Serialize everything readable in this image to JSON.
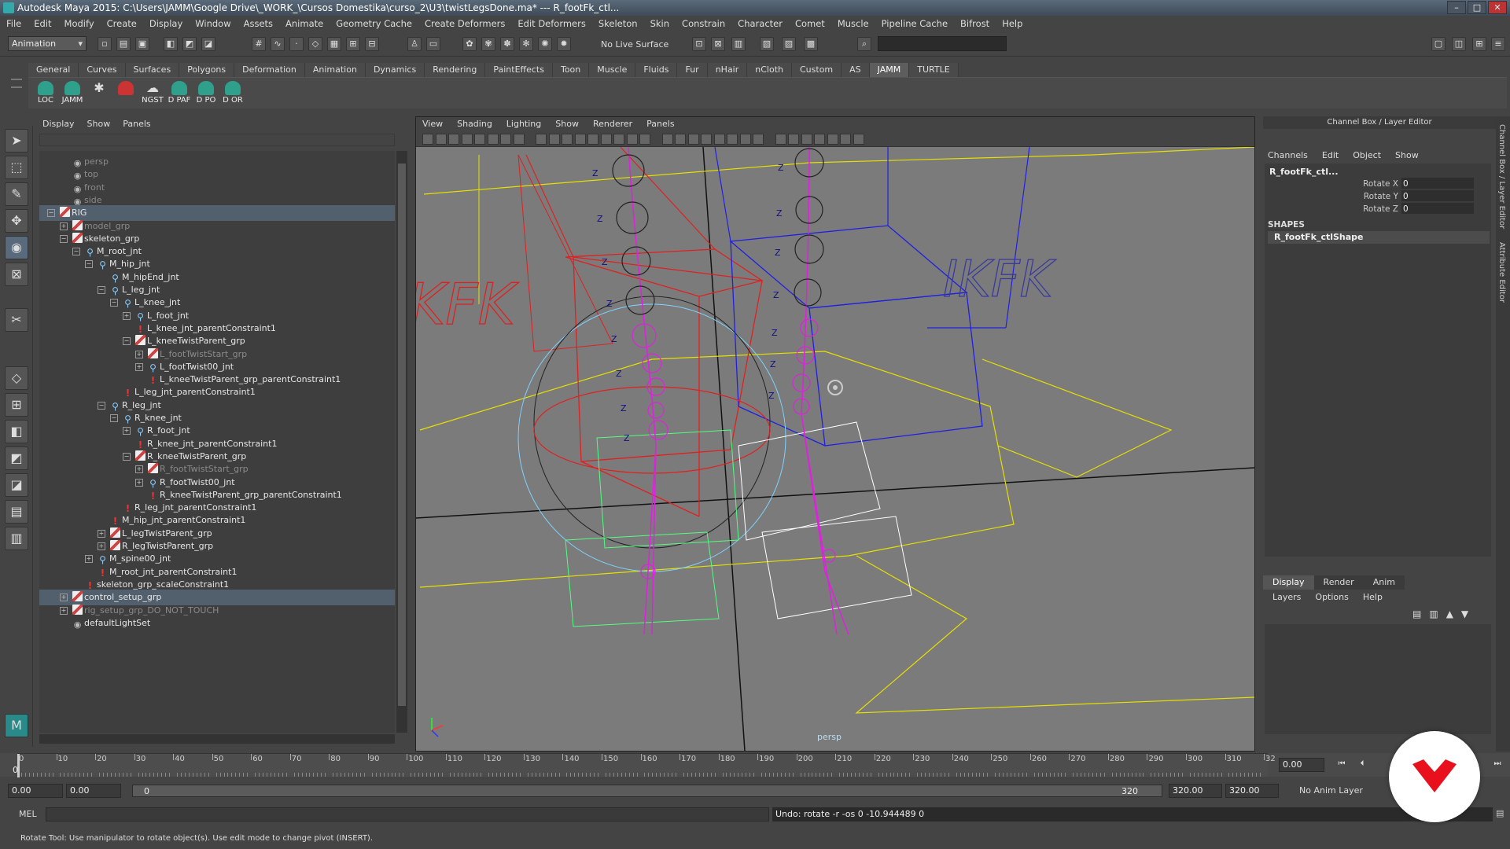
{
  "window": {
    "title": "Autodesk Maya 2015: C:\\Users\\JAMM\\Google Drive\\_WORK_\\Cursos Domestika\\curso_2\\U3\\twistLegsDone.ma*   ---   R_footFk_ctl..."
  },
  "menus": [
    "File",
    "Edit",
    "Modify",
    "Create",
    "Display",
    "Window",
    "Assets",
    "Animate",
    "Geometry Cache",
    "Create Deformers",
    "Edit Deformers",
    "Skeleton",
    "Skin",
    "Constrain",
    "Character",
    "Comet",
    "Muscle",
    "Pipeline Cache",
    "Bifrost",
    "Help"
  ],
  "toolbar": {
    "mode": "Animation",
    "live_surface": "No Live Surface"
  },
  "shelf_tabs": [
    "General",
    "Curves",
    "Surfaces",
    "Polygons",
    "Deformation",
    "Animation",
    "Dynamics",
    "Rendering",
    "PaintEffects",
    "Toon",
    "Muscle",
    "Fluids",
    "Fur",
    "nHair",
    "nCloth",
    "Custom",
    "AS",
    "JAMM",
    "TURTLE"
  ],
  "shelf_active": "JAMM",
  "shelf_buttons": [
    "LOC",
    "JAMM",
    "",
    "",
    "NGST",
    "D PAF",
    "D PO",
    "D OR"
  ],
  "outliner": {
    "menu": [
      "Display",
      "Show",
      "Panels"
    ],
    "rows": [
      {
        "label": "persp",
        "level": 2,
        "icon": "cam",
        "dim": true
      },
      {
        "label": "top",
        "level": 2,
        "icon": "cam",
        "dim": true
      },
      {
        "label": "front",
        "level": 2,
        "icon": "cam",
        "dim": true
      },
      {
        "label": "side",
        "level": 2,
        "icon": "cam",
        "dim": true
      },
      {
        "label": "RIG",
        "level": 1,
        "icon": "grp",
        "exp": "−",
        "sel": true
      },
      {
        "label": "model_grp",
        "level": 2,
        "icon": "grp",
        "exp": "+",
        "dim": true
      },
      {
        "label": "skeleton_grp",
        "level": 2,
        "icon": "grp",
        "exp": "−"
      },
      {
        "label": "M_root_jnt",
        "level": 3,
        "icon": "jnt",
        "exp": "−"
      },
      {
        "label": "M_hip_jnt",
        "level": 4,
        "icon": "jnt",
        "exp": "−"
      },
      {
        "label": "M_hipEnd_jnt",
        "level": 5,
        "icon": "jnt"
      },
      {
        "label": "L_leg_jnt",
        "level": 5,
        "icon": "jnt",
        "exp": "−"
      },
      {
        "label": "L_knee_jnt",
        "level": 6,
        "icon": "jnt",
        "exp": "−"
      },
      {
        "label": "L_foot_jnt",
        "level": 7,
        "icon": "jnt",
        "exp": "+"
      },
      {
        "label": "L_knee_jnt_parentConstraint1",
        "level": 7,
        "icon": "cns"
      },
      {
        "label": "L_kneeTwistParent_grp",
        "level": 7,
        "icon": "grp",
        "exp": "−"
      },
      {
        "label": "L_footTwistStart_grp",
        "level": 8,
        "icon": "grp",
        "exp": "+",
        "dim": true
      },
      {
        "label": "L_footTwist00_jnt",
        "level": 8,
        "icon": "jnt",
        "exp": "+"
      },
      {
        "label": "L_kneeTwistParent_grp_parentConstraint1",
        "level": 8,
        "icon": "cns"
      },
      {
        "label": "L_leg_jnt_parentConstraint1",
        "level": 6,
        "icon": "cns"
      },
      {
        "label": "R_leg_jnt",
        "level": 5,
        "icon": "jnt",
        "exp": "−"
      },
      {
        "label": "R_knee_jnt",
        "level": 6,
        "icon": "jnt",
        "exp": "−"
      },
      {
        "label": "R_foot_jnt",
        "level": 7,
        "icon": "jnt",
        "exp": "+"
      },
      {
        "label": "R_knee_jnt_parentConstraint1",
        "level": 7,
        "icon": "cns"
      },
      {
        "label": "R_kneeTwistParent_grp",
        "level": 7,
        "icon": "grp",
        "exp": "−"
      },
      {
        "label": "R_footTwistStart_grp",
        "level": 8,
        "icon": "grp",
        "exp": "+",
        "dim": true
      },
      {
        "label": "R_footTwist00_jnt",
        "level": 8,
        "icon": "jnt",
        "exp": "+"
      },
      {
        "label": "R_kneeTwistParent_grp_parentConstraint1",
        "level": 8,
        "icon": "cns"
      },
      {
        "label": "R_leg_jnt_parentConstraint1",
        "level": 6,
        "icon": "cns"
      },
      {
        "label": "M_hip_jnt_parentConstraint1",
        "level": 5,
        "icon": "cns"
      },
      {
        "label": "L_legTwistParent_grp",
        "level": 5,
        "icon": "grp",
        "exp": "+"
      },
      {
        "label": "R_legTwistParent_grp",
        "level": 5,
        "icon": "grp",
        "exp": "+"
      },
      {
        "label": "M_spine00_jnt",
        "level": 4,
        "icon": "jnt",
        "exp": "+"
      },
      {
        "label": "M_root_jnt_parentConstraint1",
        "level": 4,
        "icon": "cns"
      },
      {
        "label": "skeleton_grp_scaleConstraint1",
        "level": 3,
        "icon": "cns"
      },
      {
        "label": "control_setup_grp",
        "level": 2,
        "icon": "grp",
        "exp": "+",
        "sel": true
      },
      {
        "label": "rig_setup_grp_DO_NOT_TOUCH",
        "level": 2,
        "icon": "grp",
        "exp": "+",
        "dim": true
      },
      {
        "label": "defaultLightSet",
        "level": 2,
        "icon": "cam"
      }
    ]
  },
  "viewport": {
    "menu": [
      "View",
      "Shading",
      "Lighting",
      "Show",
      "Renderer",
      "Panels"
    ],
    "camera": "persp",
    "ikfk_text_1": "IKFK",
    "ikfk_text_2": "KFK",
    "axis_label": "Z"
  },
  "channel_box": {
    "title": "Channel Box / Layer Editor",
    "menu": [
      "Channels",
      "Edit",
      "Object",
      "Show"
    ],
    "object": "R_footFk_ctl...",
    "attrs": [
      {
        "name": "Rotate X",
        "value": "0"
      },
      {
        "name": "Rotate Y",
        "value": "0"
      },
      {
        "name": "Rotate Z",
        "value": "0"
      }
    ],
    "shapes_label": "SHAPES",
    "shape": "R_footFk_ctlShape",
    "layer_tabs": [
      "Display",
      "Render",
      "Anim"
    ],
    "layer_menu": [
      "Layers",
      "Options",
      "Help"
    ],
    "side_tabs": [
      "Channel Box / Layer Editor",
      "Attribute Editor"
    ]
  },
  "timeline": {
    "ticks": [
      "0",
      "10",
      "20",
      "30",
      "40",
      "50",
      "60",
      "70",
      "80",
      "90",
      "100",
      "110",
      "120",
      "130",
      "140",
      "150",
      "160",
      "170",
      "180",
      "190",
      "200",
      "210",
      "220",
      "230",
      "240",
      "250",
      "260",
      "270",
      "280",
      "290",
      "300",
      "310",
      "32"
    ],
    "current_frame": "0",
    "current_field": "0.00"
  },
  "range": {
    "start": "0.00",
    "start2": "0.00",
    "slider_start": "0",
    "slider_end": "320",
    "end": "320.00",
    "end2": "320.00",
    "anim_layer": "No Anim Layer"
  },
  "cmdline": {
    "label": "MEL",
    "output": "Undo: rotate -r -os 0 -10.944489 0"
  },
  "helpline": "Rotate Tool: Use manipulator to rotate object(s). Use edit mode to change pivot (INSERT)."
}
